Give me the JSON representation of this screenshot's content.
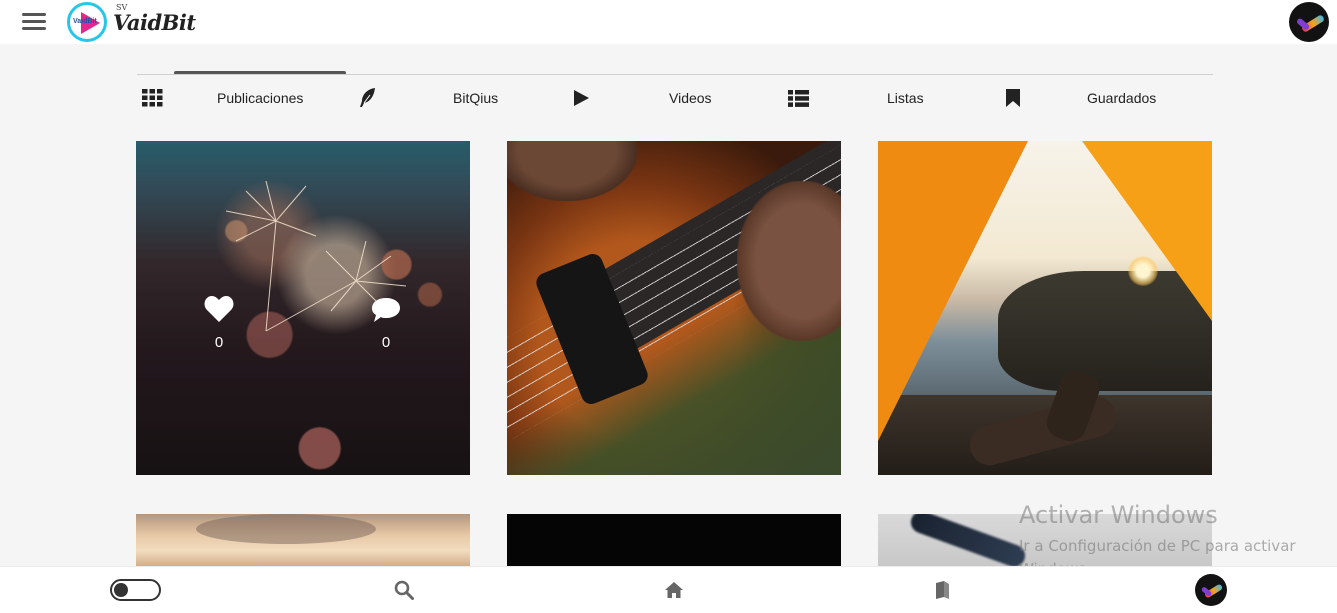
{
  "app": {
    "logo_text": "VaidBit",
    "logo_superscript": "SV",
    "logo_mini_text": "VaidBit"
  },
  "tabs": [
    {
      "label": "Publicaciones",
      "icon": "grid-icon",
      "active": true
    },
    {
      "label": "BitQius",
      "icon": "feather-icon",
      "active": false
    },
    {
      "label": "Videos",
      "icon": "play-icon",
      "active": false
    },
    {
      "label": "Listas",
      "icon": "list-icon",
      "active": false
    },
    {
      "label": "Guardados",
      "icon": "bookmark-icon",
      "active": false
    }
  ],
  "posts": [
    {
      "likes": "0",
      "comments": "0",
      "hover": true
    },
    {},
    {},
    {},
    {},
    {}
  ],
  "watermark": {
    "title": "Activar Windows",
    "subtitle": "Ir a Configuración de PC para activar Windows."
  },
  "bottom_nav": {
    "items": [
      "theme-toggle",
      "search-icon",
      "home-icon",
      "book-icon",
      "profile-avatar"
    ]
  },
  "colors": {
    "logo_ring": "#27c6e8",
    "logo_play": "#e4268f",
    "active_tab": "#555555"
  }
}
